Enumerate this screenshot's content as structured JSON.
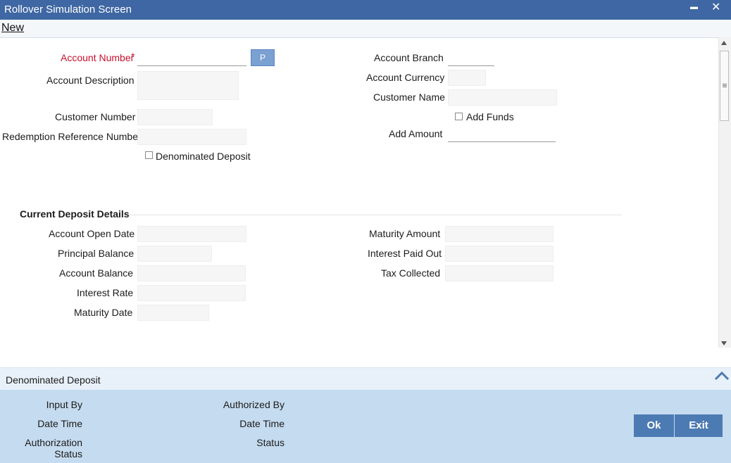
{
  "window": {
    "title": "Rollover Simulation Screen",
    "minimize": "▬",
    "close": "✕"
  },
  "menu": {
    "new": "New"
  },
  "form": {
    "account_number": {
      "label": "Account Number",
      "required": "*",
      "value": ""
    },
    "lookup_button": "P",
    "account_description": {
      "label": "Account Description",
      "value": ""
    },
    "customer_number": {
      "label": "Customer Number",
      "value": ""
    },
    "redemption_reference_number": {
      "label": "Redemption Reference Number",
      "value": ""
    },
    "denominated_deposit": {
      "label": "Denominated Deposit",
      "checked": false
    },
    "account_branch": {
      "label": "Account Branch",
      "value": ""
    },
    "account_currency": {
      "label": "Account Currency",
      "value": ""
    },
    "customer_name": {
      "label": "Customer Name",
      "value": ""
    },
    "add_funds": {
      "label": "Add Funds",
      "checked": false
    },
    "add_amount": {
      "label": "Add Amount",
      "value": ""
    }
  },
  "current_deposit": {
    "title": "Current Deposit Details",
    "account_open_date": {
      "label": "Account Open Date",
      "value": ""
    },
    "principal_balance": {
      "label": "Principal Balance",
      "value": ""
    },
    "account_balance": {
      "label": "Account Balance",
      "value": ""
    },
    "interest_rate": {
      "label": "Interest Rate",
      "value": ""
    },
    "maturity_date": {
      "label": "Maturity Date",
      "value": ""
    },
    "maturity_amount": {
      "label": "Maturity Amount",
      "value": ""
    },
    "interest_paid_out": {
      "label": "Interest Paid Out",
      "value": ""
    },
    "tax_collected": {
      "label": "Tax Collected",
      "value": ""
    }
  },
  "denominated_panel": {
    "label": "Denominated Deposit",
    "toggle_icon": "chevron-up-icon"
  },
  "audit": {
    "input_by": "Input By",
    "date_time_1": "Date Time",
    "authorization_status_line1": "Authorization",
    "authorization_status_line2": "Status",
    "authorized_by": "Authorized By",
    "date_time_2": "Date Time",
    "status": "Status"
  },
  "buttons": {
    "ok": "Ok",
    "exit": "Exit"
  },
  "colors": {
    "titlebar": "#3f67a3",
    "required": "#c8102e",
    "footer": "#c5dbef",
    "button": "#4c7ab3"
  }
}
